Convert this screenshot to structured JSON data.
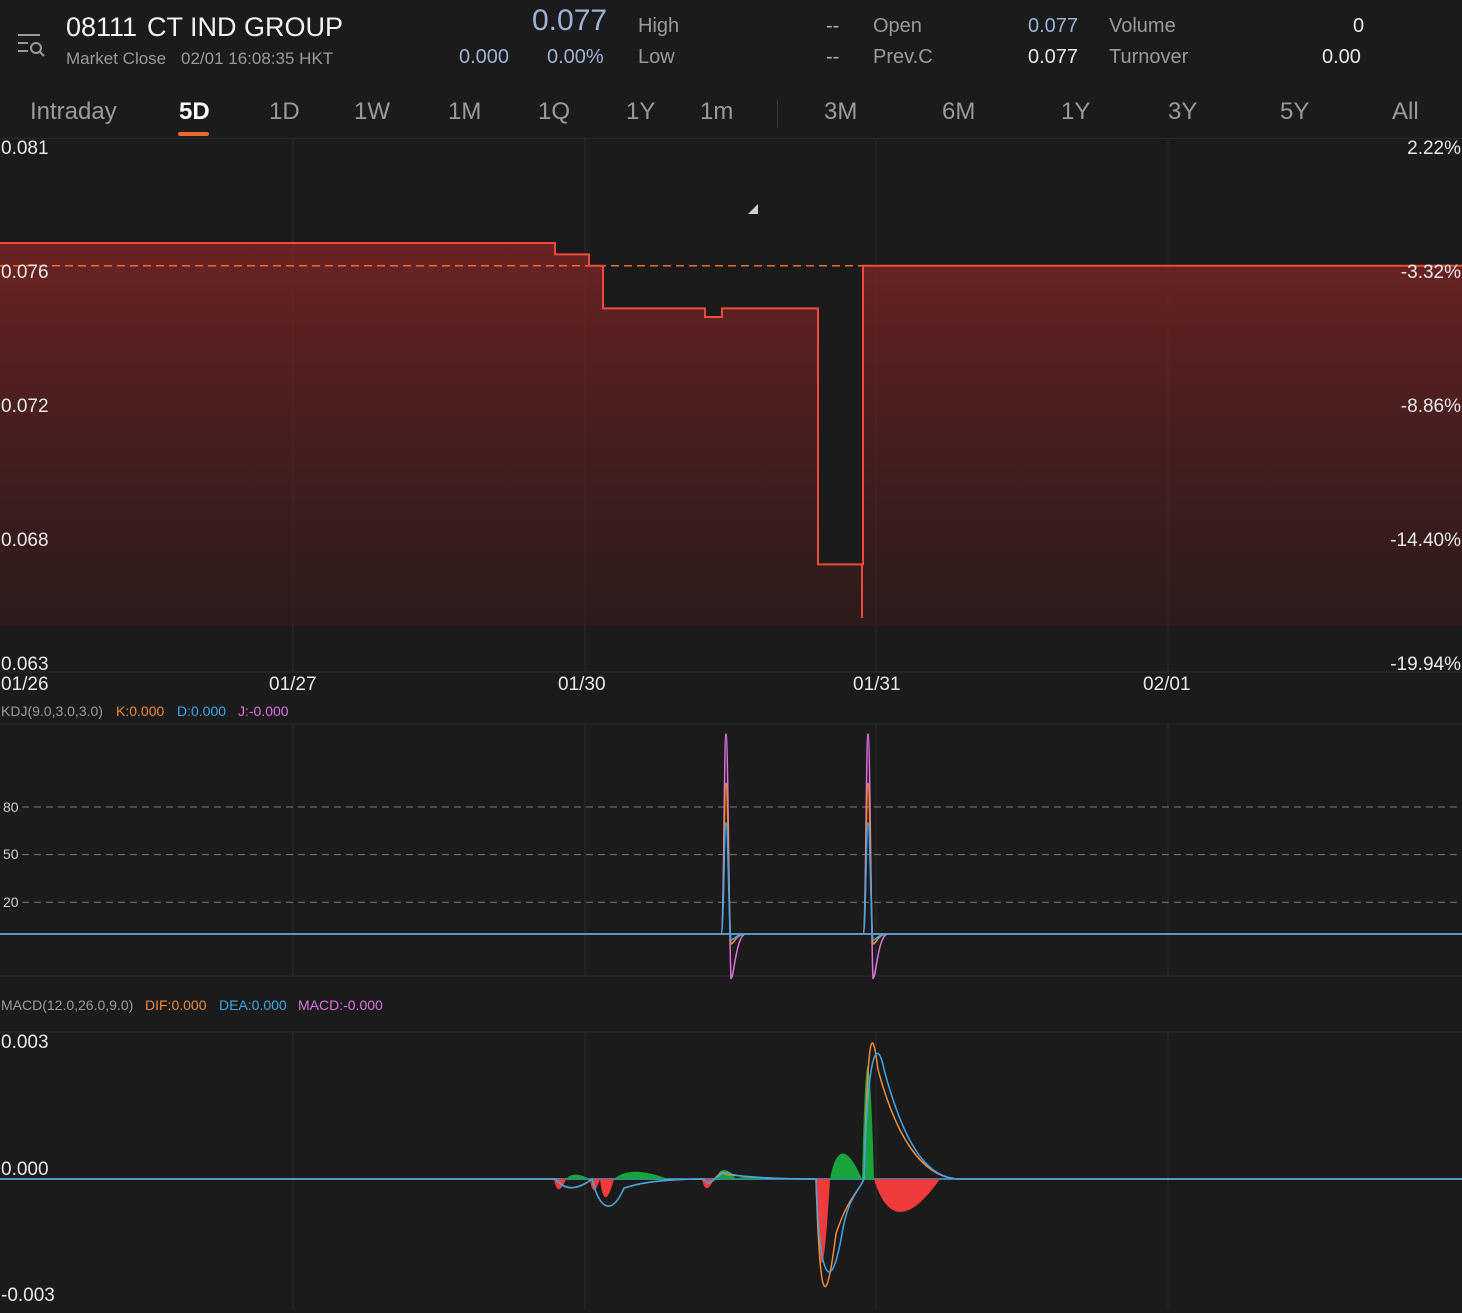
{
  "header": {
    "code": "08111",
    "name": "CT IND GROUP",
    "status": "Market Close",
    "time": "02/01 16:08:35 HKT",
    "price": "0.077",
    "change": "0.000",
    "change_pct": "0.00%",
    "stats": [
      {
        "label": "High",
        "value": "--"
      },
      {
        "label": "Low",
        "value": "--"
      },
      {
        "label": "Open",
        "value": "0.077"
      },
      {
        "label": "Prev.C",
        "value": "0.077"
      },
      {
        "label": "Volume",
        "value": "0"
      },
      {
        "label": "Turnover",
        "value": "0.00"
      }
    ],
    "menu_icon": "list-search-icon"
  },
  "tabs": [
    "Intraday",
    "5D",
    "1D",
    "1W",
    "1M",
    "1Q",
    "1Y",
    "1m",
    "3M",
    "6M",
    "1Y",
    "3Y",
    "5Y",
    "All"
  ],
  "active_tab": "5D",
  "colors": {
    "background": "#1b1b1c",
    "price_line": "#ef4a3c",
    "prev_close_line": "#ef6a2a",
    "k": "#ef8a3a",
    "d": "#3ea6e6",
    "j": "#e070e0",
    "macd_up": "#19a33b",
    "macd_down": "#ef3b3b"
  },
  "chart_data": [
    {
      "type": "line",
      "name": "price",
      "y_ticks_left": [
        "0.081",
        "0.076",
        "0.072",
        "0.068",
        "0.063"
      ],
      "y_ticks_right": [
        "2.22%",
        "-3.32%",
        "-8.86%",
        "-14.40%",
        "-19.94%"
      ],
      "x_ticks": [
        "01/26",
        "01/27",
        "01/30",
        "01/31",
        "02/01"
      ],
      "ylim": [
        0.063,
        0.081
      ],
      "prev_close": 0.077,
      "x": [
        "01/26",
        "01/27",
        "01/27",
        "01/27",
        "01/30",
        "01/30",
        "01/30",
        "01/30",
        "01/30",
        "01/31",
        "01/31",
        "02/01",
        "02/01"
      ],
      "y": [
        0.0778,
        0.0778,
        0.0774,
        0.077,
        0.0755,
        0.0752,
        0.0755,
        0.0755,
        0.0665,
        0.0665,
        0.077,
        0.077,
        0.077
      ]
    },
    {
      "type": "line",
      "name": "KDJ",
      "legend": {
        "title": "KDJ(9.0,3.0,3.0)",
        "k": "K:0.000",
        "d": "D:0.000",
        "j": "J:-0.000"
      },
      "y_ticks": [
        "80",
        "50",
        "20"
      ],
      "spikes": [
        {
          "date": "01/30",
          "peak_j": 126,
          "peak_k": 95,
          "min_j": -28
        },
        {
          "date": "01/31",
          "peak_j": 126,
          "peak_k": 95,
          "min_j": -28
        }
      ],
      "baseline": 0
    },
    {
      "type": "bar",
      "name": "MACD",
      "legend": {
        "title": "MACD(12.0,26.0,9.0)",
        "dif": "DIF:0.000",
        "dea": "DEA:0.000",
        "macd": "MACD:-0.000"
      },
      "y_ticks": [
        "0.003",
        "0.000",
        "-0.003"
      ],
      "ylim": [
        -0.003,
        0.003
      ],
      "dif_peak": 0.0034,
      "dif_min": -0.0029
    }
  ]
}
